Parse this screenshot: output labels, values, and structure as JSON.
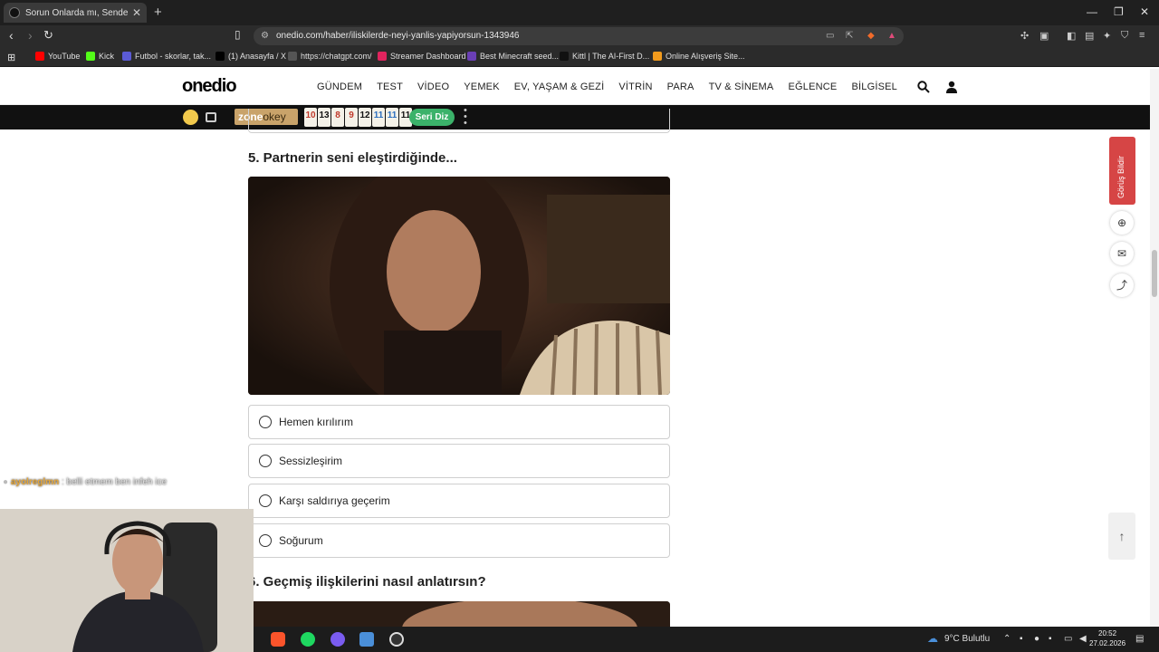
{
  "browser": {
    "tab_title": "Sorun Onlarda mı, Sende mi? - O",
    "url": "onedio.com/haber/iliskilerde-neyi-yanlis-yapiyorsun-1343946",
    "bookmarks": [
      {
        "label": "YouTube",
        "color": "#ff0000"
      },
      {
        "label": "Kick",
        "color": "#53fc18"
      },
      {
        "label": "Futbol - skorlar, tak...",
        "color": "#5b5bd6"
      },
      {
        "label": "(1) Anasayfa / X",
        "color": "#000000"
      },
      {
        "label": "https://chatgpt.com/",
        "color": "#555555"
      },
      {
        "label": "Streamer Dashboard",
        "color": "#e0245e"
      },
      {
        "label": "Best Minecraft seed...",
        "color": "#6a3fb5"
      },
      {
        "label": "Kittl | The AI-First D...",
        "color": "#111111"
      },
      {
        "label": "Online Alışveriş Site...",
        "color": "#f29b1d"
      }
    ]
  },
  "site": {
    "logo": "onedio",
    "nav": [
      "GÜNDEM",
      "TEST",
      "VİDEO",
      "YEMEK",
      "EV, YAŞAM & GEZİ",
      "VİTRİN",
      "PARA",
      "TV & SİNEMA",
      "EĞLENCE",
      "BİLGİSEL"
    ],
    "zone_logo_a": "zone",
    "zone_logo_b": "okey",
    "tiles": [
      {
        "n": "10",
        "color": "#c0392b"
      },
      {
        "n": "13",
        "color": "#111111"
      },
      {
        "n": "8",
        "color": "#c0392b"
      },
      {
        "n": "9",
        "color": "#c0392b"
      },
      {
        "n": "12",
        "color": "#111111"
      },
      {
        "n": "11",
        "color": "#2c6fbf"
      },
      {
        "n": "11",
        "color": "#2c6fbf"
      },
      {
        "n": "11",
        "color": "#111111"
      }
    ],
    "seri_diz": "Seri Diz"
  },
  "quiz": {
    "q5_title": "5. Partnerin seni eleştirdiğinde...",
    "q5_options": [
      "Hemen kırılırım",
      "Sessizleşirim",
      "Karşı saldırıya geçerim",
      "Soğurum"
    ],
    "q6_title": "6. Geçmiş ilişkilerini nasıl anlatırsın?"
  },
  "rail": {
    "gorus_bildir": "Görüş Bildir"
  },
  "chat": {
    "user": "ayolreglmn",
    "message": ": belli etmem ben infeh ice"
  },
  "taskbar": {
    "weather": "9°C  Bulutlu",
    "time": "20:52",
    "date": "27.02.2026"
  }
}
